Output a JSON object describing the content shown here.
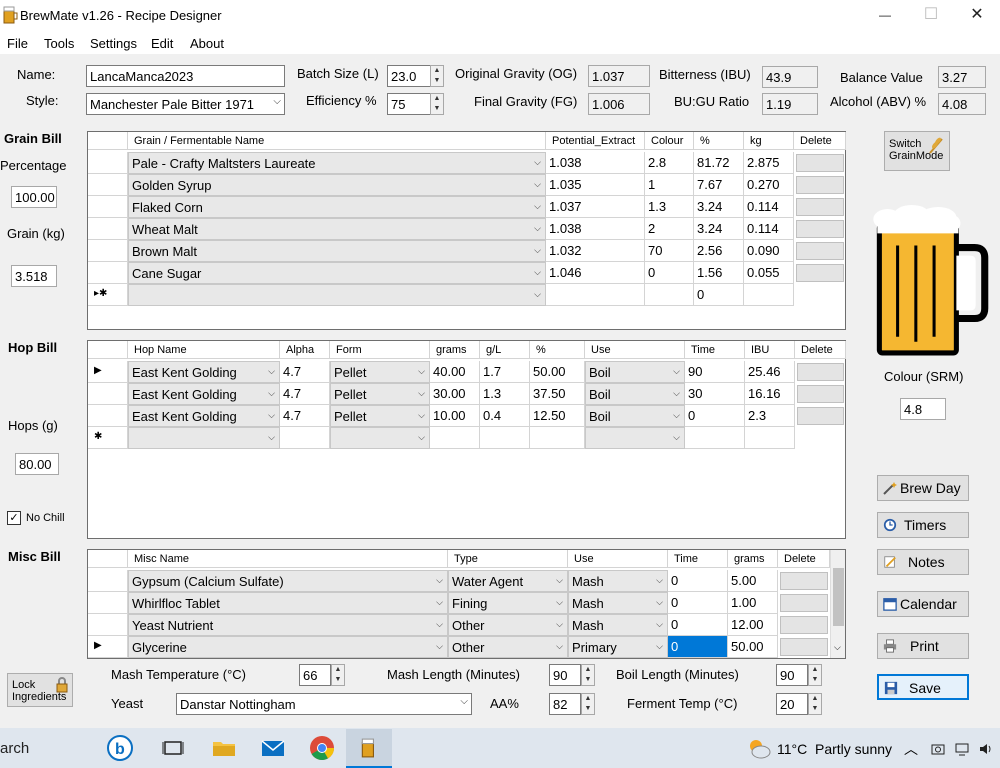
{
  "window": {
    "title": "BrewMate v1.26 - Recipe Designer",
    "minimize": "—",
    "maximize": "☐",
    "close": "✕"
  },
  "menu": [
    "File",
    "Tools",
    "Settings",
    "Edit",
    "About"
  ],
  "header": {
    "name_label": "Name:",
    "name_value": "LancaManca2023",
    "style_label": "Style:",
    "style_value": "Manchester Pale Bitter 1971",
    "batch_label": "Batch Size (L)",
    "batch_value": "23.0",
    "eff_label": "Efficiency %",
    "eff_value": "75",
    "og_label": "Original Gravity (OG)",
    "og_value": "1.037",
    "fg_label": "Final Gravity (FG)",
    "fg_value": "1.006",
    "ibu_label": "Bitterness (IBU)",
    "ibu_value": "43.9",
    "bugu_label": "BU:GU Ratio",
    "bugu_value": "1.19",
    "balance_label": "Balance Value",
    "balance_value": "3.27",
    "abv_label": "Alcohol (ABV) %",
    "abv_value": "4.08"
  },
  "grain": {
    "title": "Grain Bill",
    "percentage_label": "Percentage",
    "percentage_value": "100.00",
    "grain_kg_label": "Grain (kg)",
    "grain_kg_value": "3.518",
    "columns": [
      "Grain / Fermentable Name",
      "Potential_Extract",
      "Colour",
      "%",
      "kg",
      "Delete"
    ],
    "rows": [
      [
        "Pale - Crafty Maltsters Laureate",
        "1.038",
        "2.8",
        "81.72",
        "2.875"
      ],
      [
        "Golden Syrup",
        "1.035",
        "1",
        "7.67",
        "0.270"
      ],
      [
        "Flaked Corn",
        "1.037",
        "1.3",
        "3.24",
        "0.114"
      ],
      [
        "Wheat Malt",
        "1.038",
        "2",
        "3.24",
        "0.114"
      ],
      [
        "Brown Malt",
        "1.032",
        "70",
        "2.56",
        "0.090"
      ],
      [
        "Cane Sugar",
        "1.046",
        "0",
        "1.56",
        "0.055"
      ]
    ],
    "new_row_marker": "▸✱",
    "new_row_pct": "0",
    "switch_label_1": "Switch",
    "switch_label_2": "GrainMode"
  },
  "colour": {
    "label": "Colour (SRM)",
    "value": "4.8",
    "beer_color": "#f5b731"
  },
  "hop": {
    "title": "Hop Bill",
    "hops_label": "Hops (g)",
    "hops_value": "80.00",
    "nochill_label": "No Chill",
    "columns": [
      "Hop Name",
      "Alpha",
      "Form",
      "grams",
      "g/L",
      "%",
      "Use",
      "Time",
      "IBU",
      "Delete"
    ],
    "rows": [
      [
        "East Kent Golding",
        "4.7",
        "Pellet",
        "40.00",
        "1.7",
        "50.00",
        "Boil",
        "90",
        "25.46"
      ],
      [
        "East Kent Golding",
        "4.7",
        "Pellet",
        "30.00",
        "1.3",
        "37.50",
        "Boil",
        "30",
        "16.16"
      ],
      [
        "East Kent Golding",
        "4.7",
        "Pellet",
        "10.00",
        "0.4",
        "12.50",
        "Boil",
        "0",
        "2.3"
      ]
    ],
    "current_marker": "▶",
    "new_row_marker": "✱"
  },
  "misc": {
    "title": "Misc Bill",
    "columns": [
      "Misc Name",
      "Type",
      "Use",
      "Time",
      "grams",
      "Delete"
    ],
    "rows": [
      [
        "Gypsum (Calcium Sulfate)",
        "Water Agent",
        "Mash",
        "0",
        "5.00"
      ],
      [
        "Whirlfloc Tablet",
        "Fining",
        "Mash",
        "0",
        "1.00"
      ],
      [
        "Yeast Nutrient",
        "Other",
        "Mash",
        "0",
        "12.00"
      ],
      [
        "Glycerine",
        "Other",
        "Primary",
        "0",
        "50.00"
      ]
    ],
    "current_marker": "▶"
  },
  "bottom": {
    "lock_label_1": "Lock",
    "lock_label_2": "Ingredients",
    "mash_temp_label": "Mash Temperature (°C)",
    "mash_temp_value": "66",
    "mash_len_label": "Mash Length (Minutes)",
    "mash_len_value": "90",
    "boil_len_label": "Boil Length (Minutes)",
    "boil_len_value": "90",
    "yeast_label": "Yeast",
    "yeast_value": "Danstar Nottingham",
    "aa_label": "AA%",
    "aa_value": "82",
    "ferment_label": "Ferment Temp (°C)",
    "ferment_value": "20"
  },
  "actions": {
    "brewday": "Brew Day",
    "timers": "Timers",
    "notes": "Notes",
    "calendar": "Calendar",
    "print": "Print",
    "save": "Save"
  },
  "taskbar": {
    "search": "arch",
    "weather_temp": "11°C",
    "weather_text": "Partly sunny"
  }
}
